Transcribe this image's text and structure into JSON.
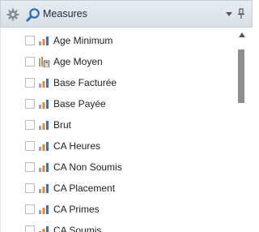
{
  "panel": {
    "title": "Measures",
    "icons": {
      "settings": "gear-icon",
      "search": "search-icon",
      "dropdown": "chevron-down-icon",
      "pin": "pin-icon"
    }
  },
  "measures": [
    {
      "label": "Age Minimum",
      "checked": false,
      "icon": "bar-chart-icon"
    },
    {
      "label": "Age Moyen",
      "checked": false,
      "icon": "calculated-measure-icon"
    },
    {
      "label": "Base Facturée",
      "checked": false,
      "icon": "bar-chart-icon"
    },
    {
      "label": "Base Payée",
      "checked": false,
      "icon": "bar-chart-icon"
    },
    {
      "label": "Brut",
      "checked": false,
      "icon": "bar-chart-icon"
    },
    {
      "label": "CA Heures",
      "checked": false,
      "icon": "bar-chart-icon"
    },
    {
      "label": "CA Non Soumis",
      "checked": false,
      "icon": "bar-chart-icon"
    },
    {
      "label": "CA Placement",
      "checked": false,
      "icon": "bar-chart-icon"
    },
    {
      "label": "CA Primes",
      "checked": false,
      "icon": "bar-chart-icon"
    },
    {
      "label": "CA Soumis",
      "checked": false,
      "icon": "bar-chart-icon"
    }
  ],
  "colors": {
    "bar_gray": "#9aa3ad",
    "bar_orange": "#e8862a",
    "bar_blue": "#3a72b8",
    "search_blue": "#2f6db3"
  }
}
